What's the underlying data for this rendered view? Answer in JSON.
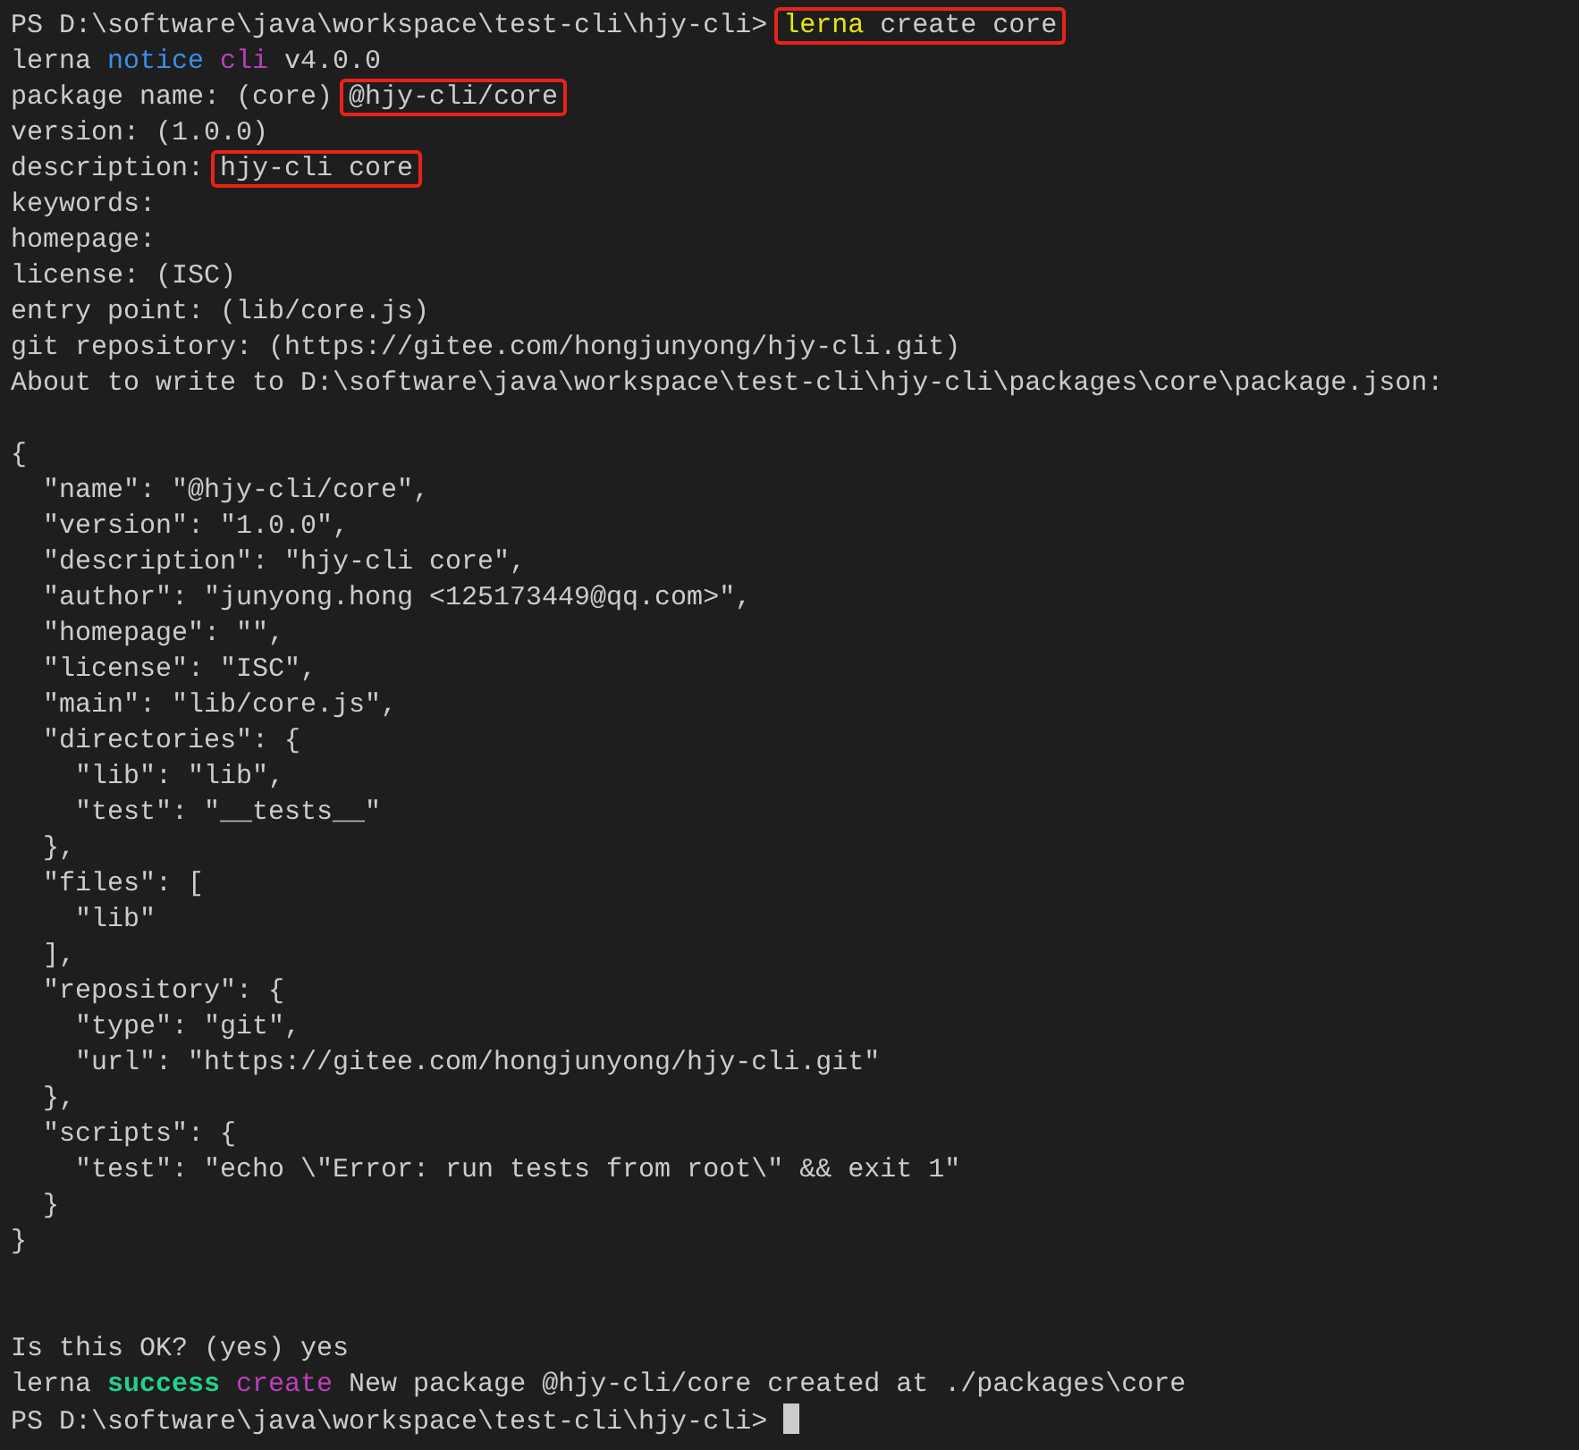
{
  "terminal": {
    "lines": [
      {
        "kind": "text",
        "segments": [
          {
            "text": "PS D:\\software\\java\\workspace\\test-cli\\hjy-cli> ",
            "kind": "plain",
            "boxed": false
          },
          {
            "text": "lerna",
            "kind": "command",
            "boxed": true
          },
          {
            "text": " create core",
            "kind": "plain",
            "boxed": true
          }
        ]
      },
      {
        "kind": "text",
        "segments": [
          {
            "text": "lerna ",
            "kind": "plain",
            "boxed": false
          },
          {
            "text": "notice ",
            "kind": "level",
            "boxed": false
          },
          {
            "text": "cli",
            "kind": "tag",
            "boxed": false
          },
          {
            "text": " v4.0.0",
            "kind": "plain",
            "boxed": false
          }
        ]
      },
      {
        "kind": "text",
        "segments": [
          {
            "text": "package name: (core) ",
            "kind": "plain",
            "boxed": false
          },
          {
            "text": "@hjy-cli/core",
            "kind": "plain",
            "boxed": true
          }
        ]
      },
      {
        "kind": "text",
        "segments": [
          {
            "text": "version: (1.0.0)",
            "kind": "plain",
            "boxed": false
          }
        ]
      },
      {
        "kind": "text",
        "segments": [
          {
            "text": "description: ",
            "kind": "plain",
            "boxed": false
          },
          {
            "text": "hjy-cli core",
            "kind": "plain",
            "boxed": true
          }
        ]
      },
      {
        "kind": "text",
        "segments": [
          {
            "text": "keywords:",
            "kind": "plain",
            "boxed": false
          }
        ]
      },
      {
        "kind": "text",
        "segments": [
          {
            "text": "homepage:",
            "kind": "plain",
            "boxed": false
          }
        ]
      },
      {
        "kind": "text",
        "segments": [
          {
            "text": "license: (ISC)",
            "kind": "plain",
            "boxed": false
          }
        ]
      },
      {
        "kind": "text",
        "segments": [
          {
            "text": "entry point: (lib/core.js)",
            "kind": "plain",
            "boxed": false
          }
        ]
      },
      {
        "kind": "text",
        "segments": [
          {
            "text": "git repository: (https://gitee.com/hongjunyong/hjy-cli.git)",
            "kind": "plain",
            "boxed": false
          }
        ]
      },
      {
        "kind": "text",
        "segments": [
          {
            "text": "About to write to D:\\software\\java\\workspace\\test-cli\\hjy-cli\\packages\\core\\package.json:",
            "kind": "plain",
            "boxed": false
          }
        ]
      },
      {
        "kind": "blank"
      },
      {
        "kind": "text",
        "segments": [
          {
            "text": "{",
            "kind": "plain",
            "boxed": false
          }
        ]
      },
      {
        "kind": "text",
        "segments": [
          {
            "text": "  \"name\": \"@hjy-cli/core\",",
            "kind": "plain",
            "boxed": false
          }
        ]
      },
      {
        "kind": "text",
        "segments": [
          {
            "text": "  \"version\": \"1.0.0\",",
            "kind": "plain",
            "boxed": false
          }
        ]
      },
      {
        "kind": "text",
        "segments": [
          {
            "text": "  \"description\": \"hjy-cli core\",",
            "kind": "plain",
            "boxed": false
          }
        ]
      },
      {
        "kind": "text",
        "segments": [
          {
            "text": "  \"author\": \"junyong.hong <125173449@qq.com>\",",
            "kind": "plain",
            "boxed": false
          }
        ]
      },
      {
        "kind": "text",
        "segments": [
          {
            "text": "  \"homepage\": \"\",",
            "kind": "plain",
            "boxed": false
          }
        ]
      },
      {
        "kind": "text",
        "segments": [
          {
            "text": "  \"license\": \"ISC\",",
            "kind": "plain",
            "boxed": false
          }
        ]
      },
      {
        "kind": "text",
        "segments": [
          {
            "text": "  \"main\": \"lib/core.js\",",
            "kind": "plain",
            "boxed": false
          }
        ]
      },
      {
        "kind": "text",
        "segments": [
          {
            "text": "  \"directories\": {",
            "kind": "plain",
            "boxed": false
          }
        ]
      },
      {
        "kind": "text",
        "segments": [
          {
            "text": "    \"lib\": \"lib\",",
            "kind": "plain",
            "boxed": false
          }
        ]
      },
      {
        "kind": "text",
        "segments": [
          {
            "text": "    \"test\": \"__tests__\"",
            "kind": "plain",
            "boxed": false
          }
        ]
      },
      {
        "kind": "text",
        "segments": [
          {
            "text": "  },",
            "kind": "plain",
            "boxed": false
          }
        ]
      },
      {
        "kind": "text",
        "segments": [
          {
            "text": "  \"files\": [",
            "kind": "plain",
            "boxed": false
          }
        ]
      },
      {
        "kind": "text",
        "segments": [
          {
            "text": "    \"lib\"",
            "kind": "plain",
            "boxed": false
          }
        ]
      },
      {
        "kind": "text",
        "segments": [
          {
            "text": "  ],",
            "kind": "plain",
            "boxed": false
          }
        ]
      },
      {
        "kind": "text",
        "segments": [
          {
            "text": "  \"repository\": {",
            "kind": "plain",
            "boxed": false
          }
        ]
      },
      {
        "kind": "text",
        "segments": [
          {
            "text": "    \"type\": \"git\",",
            "kind": "plain",
            "boxed": false
          }
        ]
      },
      {
        "kind": "text",
        "segments": [
          {
            "text": "    \"url\": \"https://gitee.com/hongjunyong/hjy-cli.git\"",
            "kind": "plain",
            "boxed": false
          }
        ]
      },
      {
        "kind": "text",
        "segments": [
          {
            "text": "  },",
            "kind": "plain",
            "boxed": false
          }
        ]
      },
      {
        "kind": "text",
        "segments": [
          {
            "text": "  \"scripts\": {",
            "kind": "plain",
            "boxed": false
          }
        ]
      },
      {
        "kind": "text",
        "segments": [
          {
            "text": "    \"test\": \"echo \\\"Error: run tests from root\\\" && exit 1\"",
            "kind": "plain",
            "boxed": false
          }
        ]
      },
      {
        "kind": "text",
        "segments": [
          {
            "text": "  }",
            "kind": "plain",
            "boxed": false
          }
        ]
      },
      {
        "kind": "text",
        "segments": [
          {
            "text": "}",
            "kind": "plain",
            "boxed": false
          }
        ]
      },
      {
        "kind": "blank"
      },
      {
        "kind": "blank"
      },
      {
        "kind": "text",
        "segments": [
          {
            "text": "Is this OK? (yes) yes",
            "kind": "plain",
            "boxed": false
          }
        ]
      },
      {
        "kind": "text",
        "segments": [
          {
            "text": "lerna ",
            "kind": "plain",
            "boxed": false
          },
          {
            "text": "success ",
            "kind": "success",
            "boxed": false
          },
          {
            "text": "create",
            "kind": "tag",
            "boxed": false
          },
          {
            "text": " New package @hjy-cli/core created at ./packages\\core",
            "kind": "plain",
            "boxed": false
          }
        ]
      },
      {
        "kind": "text",
        "segments": [
          {
            "text": "PS D:\\software\\java\\workspace\\test-cli\\hjy-cli> ",
            "kind": "plain",
            "boxed": false
          }
        ],
        "cursor": true
      }
    ]
  }
}
